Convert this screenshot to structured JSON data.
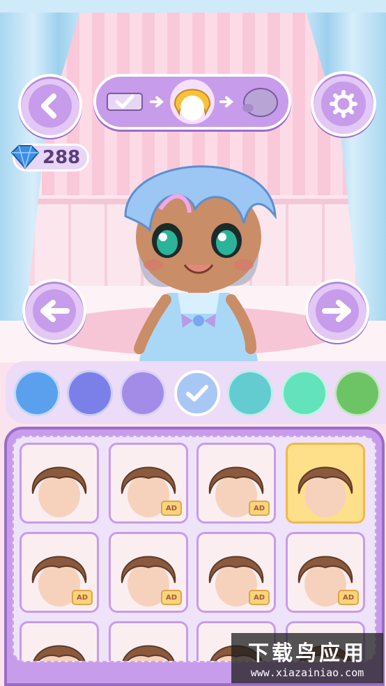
{
  "colors": {
    "accent": "#c79cea",
    "accent_dark": "#9b6cc7"
  },
  "toolbar": {
    "back_icon": "chevron-left-icon",
    "settings_icon": "gear-icon",
    "steps": [
      {
        "name": "outfit-step-icon",
        "state": "done"
      },
      {
        "name": "hair-step-icon",
        "state": "current"
      },
      {
        "name": "hat-step-icon",
        "state": "next"
      }
    ]
  },
  "currency": {
    "gems": "288",
    "icon": "diamond-icon"
  },
  "nav": {
    "prev_icon": "arrow-left-icon",
    "next_icon": "arrow-right-icon"
  },
  "swatches": [
    {
      "color": "#5aa0ec",
      "selected": false
    },
    {
      "color": "#7a80e8",
      "selected": false
    },
    {
      "color": "#a38ce8",
      "selected": false
    },
    {
      "color": "#a9c7f5",
      "selected": true
    },
    {
      "color": "#62ccd0",
      "selected": false
    },
    {
      "color": "#62e3bb",
      "selected": false
    },
    {
      "color": "#6cc464",
      "selected": false
    }
  ],
  "hair_items": [
    {
      "ad": false,
      "selected": false,
      "ad_label": ""
    },
    {
      "ad": true,
      "selected": false,
      "ad_label": "AD"
    },
    {
      "ad": true,
      "selected": false,
      "ad_label": "AD"
    },
    {
      "ad": false,
      "selected": true,
      "ad_label": ""
    },
    {
      "ad": true,
      "selected": false,
      "ad_label": "AD"
    },
    {
      "ad": true,
      "selected": false,
      "ad_label": "AD"
    },
    {
      "ad": true,
      "selected": false,
      "ad_label": "AD"
    },
    {
      "ad": true,
      "selected": false,
      "ad_label": "AD"
    },
    {
      "ad": false,
      "selected": false,
      "ad_label": ""
    },
    {
      "ad": false,
      "selected": false,
      "ad_label": ""
    },
    {
      "ad": false,
      "selected": false,
      "ad_label": ""
    },
    {
      "ad": false,
      "selected": false,
      "ad_label": ""
    }
  ],
  "watermark": {
    "title": "下载鸟应用",
    "url": "www.xiazainiao.com"
  }
}
